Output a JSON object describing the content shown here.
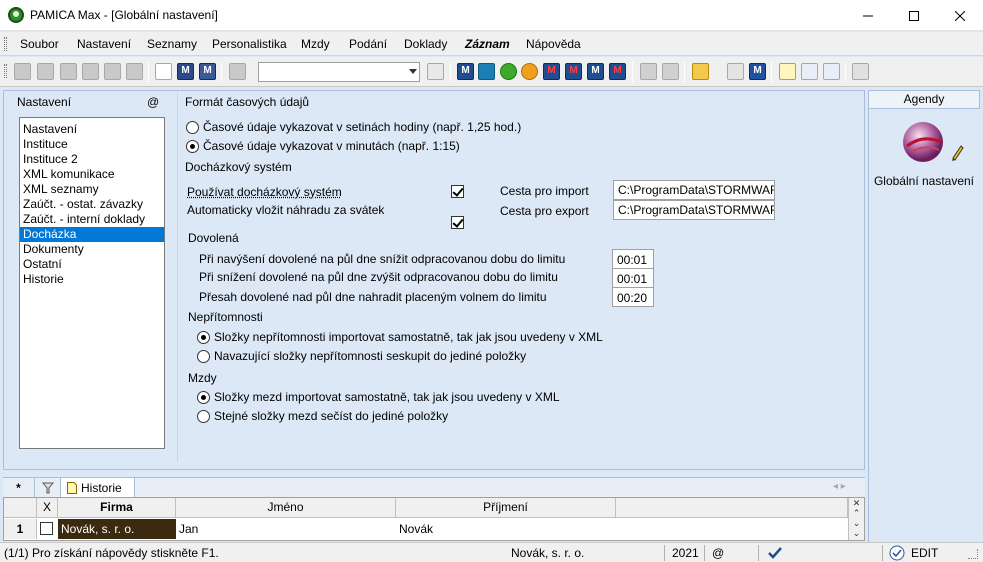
{
  "window": {
    "title": "PAMICA Max - [Globální nastavení]",
    "min_icon": "minimize-icon",
    "max_icon": "maximize-icon",
    "close_icon": "close-icon"
  },
  "menu": [
    {
      "label": "Soubor",
      "bold": false
    },
    {
      "label": "Nastavení",
      "bold": false
    },
    {
      "label": "Seznamy",
      "bold": false
    },
    {
      "label": "Personalistika",
      "bold": false
    },
    {
      "label": "Mzdy",
      "bold": false
    },
    {
      "label": "Podání",
      "bold": false
    },
    {
      "label": "Doklady",
      "bold": false
    },
    {
      "label": "Záznam",
      "bold": true
    },
    {
      "label": "Nápověda",
      "bold": false
    }
  ],
  "toolbar": {
    "combo_value": ""
  },
  "nav": {
    "title": "Nastavení",
    "at_label": "@",
    "items": [
      "Nastavení",
      "Instituce",
      "Instituce 2",
      "XML komunikace",
      "XML seznamy",
      "Zaúčt. - ostat. závazky",
      "Zaúčt. - interní doklady",
      "Docházka",
      "Dokumenty",
      "Ostatní",
      "Historie"
    ],
    "selected_index": 7
  },
  "time_format": {
    "title": "Formát časových údajů",
    "options": [
      {
        "label": "Časové údaje vykazovat v setinách hodiny (např. 1,25 hod.)",
        "selected": false
      },
      {
        "label": "Časové údaje vykazovat v minutách (např. 1:15)",
        "selected": true
      }
    ]
  },
  "attendance": {
    "title": "Docházkový systém",
    "use_system": {
      "label": "Používat docházkový systém",
      "checked": true
    },
    "auto_holiday": {
      "label": "Automaticky vložit náhradu za svátek",
      "checked": true
    },
    "import_label": "Cesta pro import",
    "import_path": "C:\\ProgramData\\STORMWARE",
    "export_label": "Cesta pro export",
    "export_path": "C:\\ProgramData\\STORMWARE"
  },
  "vacation": {
    "title": "Dovolená",
    "rows": [
      {
        "label": "Při navýšení dovolené na půl dne snížit odpracovanou dobu do limitu",
        "value": "00:01"
      },
      {
        "label": "Při snížení dovolené na půl dne zvýšit odpracovanou dobu do limitu",
        "value": "00:01"
      },
      {
        "label": "Přesah dovolené nad půl dne nahradit placeným volnem do limitu",
        "value": "00:20"
      }
    ]
  },
  "absence": {
    "title": "Nepřítomnosti",
    "options": [
      {
        "label": "Složky nepřítomnosti importovat samostatně, tak jak jsou uvedeny v XML",
        "selected": true
      },
      {
        "label": "Navazující složky nepřítomnosti seskupit do jediné položky",
        "selected": false
      }
    ]
  },
  "wages": {
    "title": "Mzdy",
    "options": [
      {
        "label": "Složky mezd importovat samostatně, tak jak jsou uvedeny v XML",
        "selected": true
      },
      {
        "label": "Stejné složky mezd sečíst do jediné položky",
        "selected": false
      }
    ]
  },
  "agenda": {
    "header": "Agendy",
    "item_label": "Globální nastavení",
    "icon": "globe-pencil-icon"
  },
  "bottom": {
    "tab_star": "*",
    "tab_history": "Historie",
    "grid": {
      "columns": [
        "X",
        "Firma",
        "Jméno",
        "Příjmení"
      ],
      "rows": [
        {
          "num": "1",
          "firma": "Novák, s. r. o.",
          "jmeno": "Jan",
          "prijmeni": "Novák"
        }
      ]
    }
  },
  "status": {
    "help": "(1/1) Pro získání nápovědy stiskněte F1.",
    "company": "Novák, s. r. o.",
    "year": "2021",
    "at": "@",
    "mode": "EDIT"
  },
  "colors": {
    "selection": "#0078d7",
    "panel_bg": "#dde8f6",
    "grid_firma_bg": "#3c2a10"
  }
}
